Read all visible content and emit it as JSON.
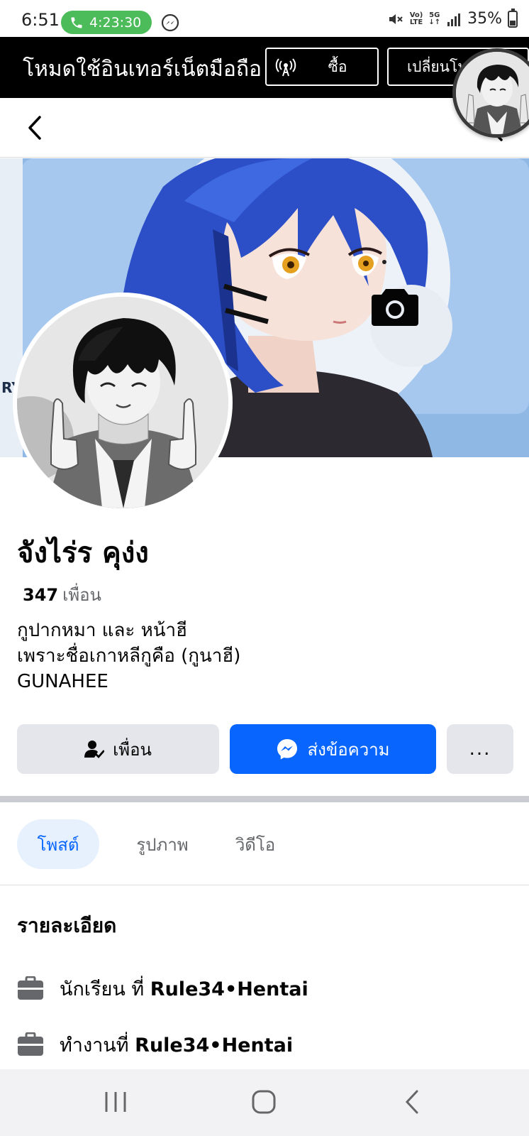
{
  "status_bar": {
    "time": "6:51",
    "call_timer": "4:23:30",
    "network": "5G",
    "volte": "VoLTE",
    "battery": "35%"
  },
  "data_banner": {
    "text": "โหมดใช้อินเทอร์เน็ตมือถือ",
    "buy_label": "ซื้อ",
    "switch_label": "เปลี่ยนโหมด"
  },
  "profile": {
    "name": "จังไร่ร คุง่ง",
    "friend_count": "347",
    "friend_label": "เพื่อน",
    "bio": [
      "กูปากหมา และ หน้าฮี",
      "เพราะชื่อเกาหลีกูคือ (กูนาฮี)",
      "GUNAHEE"
    ]
  },
  "actions": {
    "friends_label": "เพื่อน",
    "message_label": "ส่งข้อความ",
    "more_label": "..."
  },
  "tabs": [
    {
      "label": "โพสต์",
      "active": true
    },
    {
      "label": "รูปภาพ",
      "active": false
    },
    {
      "label": "วิดีโอ",
      "active": false
    }
  ],
  "details": {
    "heading": "รายละเอียด",
    "items": [
      {
        "icon": "briefcase-icon",
        "prefix": "นักเรียน ที่",
        "place": "Rule34•Hentai"
      },
      {
        "icon": "briefcase-icon",
        "prefix": "ทำงานที่",
        "place": "Rule34•Hentai"
      }
    ]
  },
  "colors": {
    "accent_blue": "#0866ff",
    "call_green": "#4cbb5a",
    "banner_black": "#000000",
    "button_gray": "#e4e6eb"
  }
}
